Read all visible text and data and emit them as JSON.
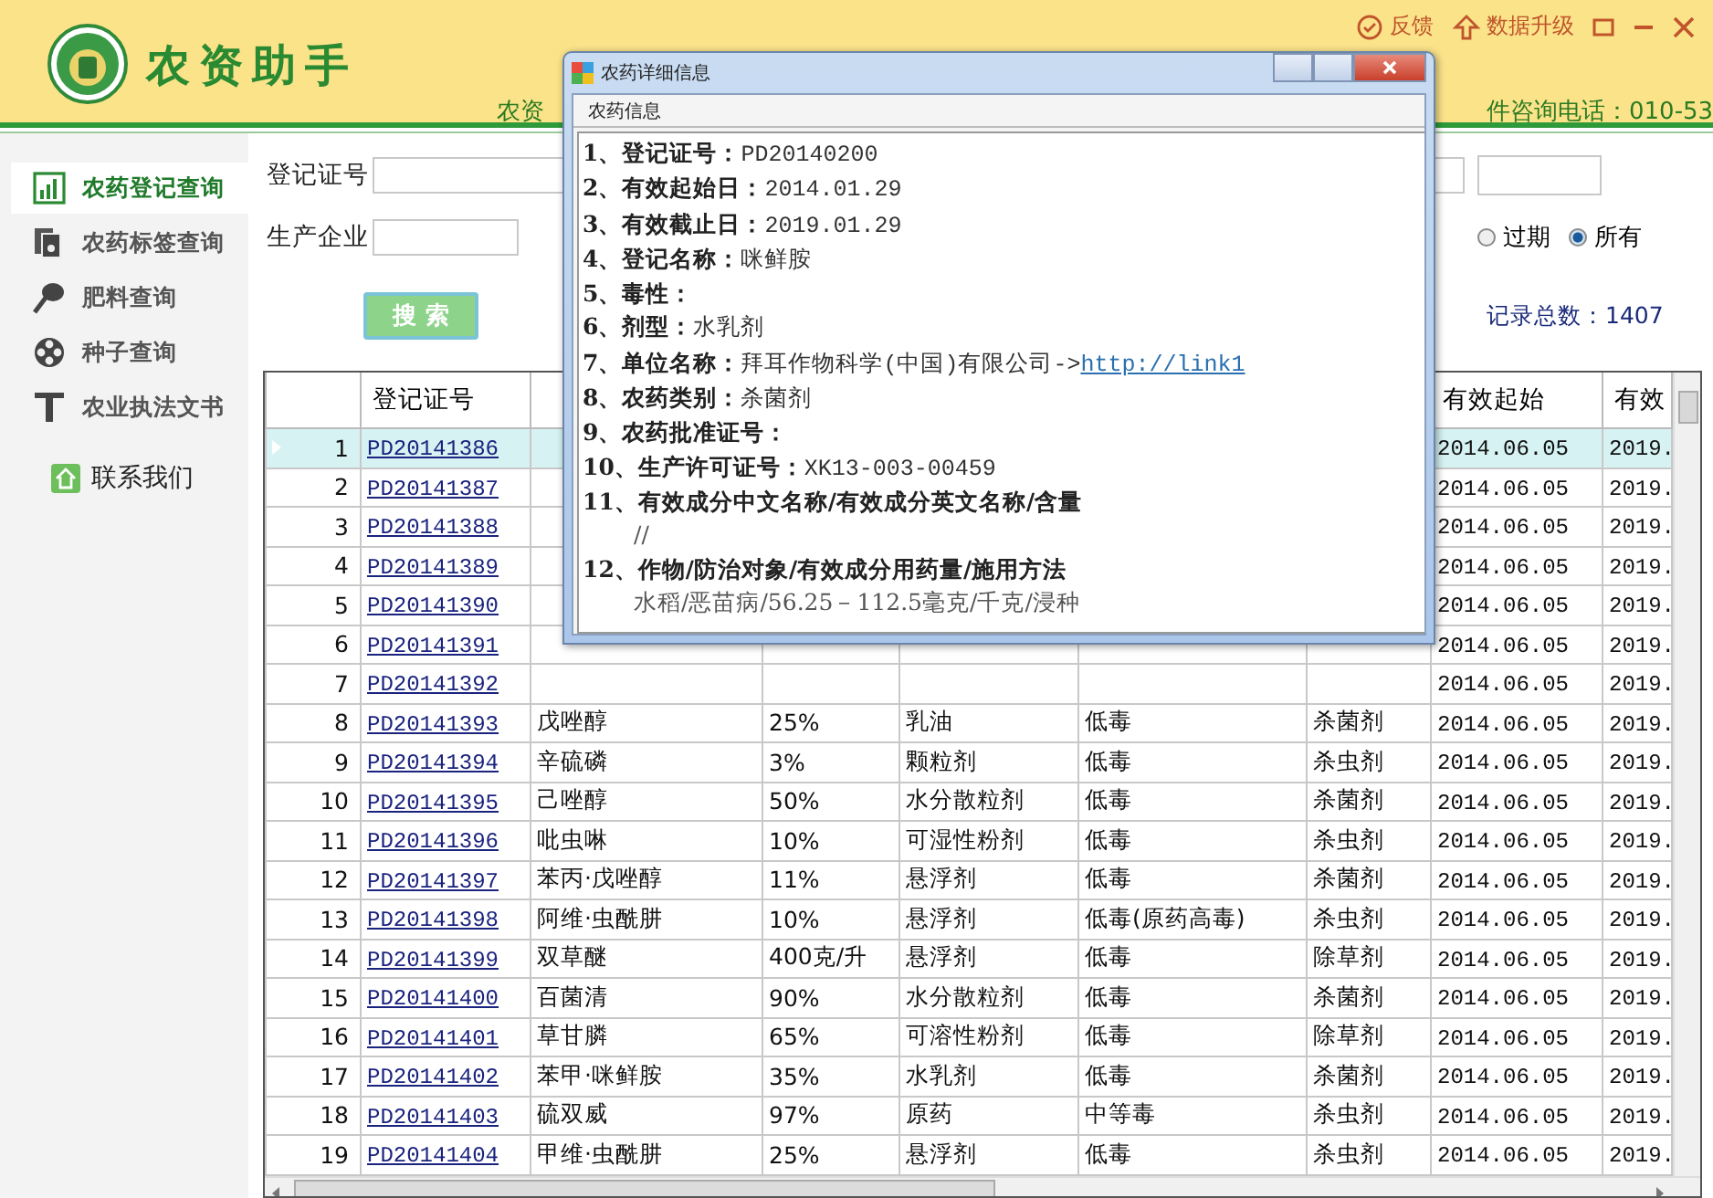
{
  "header": {
    "app_title": "农资助手",
    "marquee_left": "农资",
    "marquee_right": "件咨询电话：010-53",
    "actions": [
      {
        "kind": "feedback",
        "label": "反馈"
      },
      {
        "kind": "upgrade",
        "label": "数据升级"
      }
    ]
  },
  "sidebar": {
    "items": [
      {
        "kind": "chart",
        "label": "农药登记查询",
        "selected": true
      },
      {
        "kind": "label",
        "label": "农药标签查询",
        "selected": false
      },
      {
        "kind": "fertilizer",
        "label": "肥料查询",
        "selected": false
      },
      {
        "kind": "seed",
        "label": "种子查询",
        "selected": false
      },
      {
        "kind": "text",
        "label": "农业执法文书",
        "selected": false
      }
    ],
    "contact": {
      "label": "联系我们"
    }
  },
  "search": {
    "fields": [
      {
        "label": "登记证号"
      },
      {
        "label": "生产企业"
      }
    ],
    "button": "搜 索",
    "radios": [
      {
        "label": "过期",
        "selected": false
      },
      {
        "label": "所有",
        "selected": true
      }
    ],
    "record_count": "记录总数：1407"
  },
  "table": {
    "columns": {
      "reg": "登记证号",
      "start": "有效起始",
      "end": "有效"
    },
    "rows": [
      {
        "no": "1",
        "reg": "PD20141386",
        "start": "2014.06.05",
        "end": "2019.",
        "selected": true
      },
      {
        "no": "2",
        "reg": "PD20141387",
        "start": "2014.06.05",
        "end": "2019.",
        "selected": false
      },
      {
        "no": "3",
        "reg": "PD20141388",
        "start": "2014.06.05",
        "end": "2019.",
        "selected": false
      },
      {
        "no": "4",
        "reg": "PD20141389",
        "start": "2014.06.05",
        "end": "2019.",
        "selected": false
      },
      {
        "no": "5",
        "reg": "PD20141390",
        "start": "2014.06.05",
        "end": "2019.",
        "selected": false
      },
      {
        "no": "6",
        "reg": "PD20141391",
        "start": "2014.06.05",
        "end": "2019.",
        "selected": false
      },
      {
        "no": "7",
        "reg": "PD20141392",
        "start": "2014.06.05",
        "end": "2019.",
        "selected": false
      },
      {
        "no": "8",
        "reg": "PD20141393",
        "name": "戊唑醇",
        "content": "25%",
        "form": "乳油",
        "toxicity": "低毒",
        "category": "杀菌剂",
        "start": "2014.06.05",
        "end": "2019.",
        "selected": false
      },
      {
        "no": "9",
        "reg": "PD20141394",
        "name": "辛硫磷",
        "content": "3%",
        "form": "颗粒剂",
        "toxicity": "低毒",
        "category": "杀虫剂",
        "start": "2014.06.05",
        "end": "2019.",
        "selected": false
      },
      {
        "no": "10",
        "reg": "PD20141395",
        "name": "己唑醇",
        "content": "50%",
        "form": "水分散粒剂",
        "toxicity": "低毒",
        "category": "杀菌剂",
        "start": "2014.06.05",
        "end": "2019.",
        "selected": false
      },
      {
        "no": "11",
        "reg": "PD20141396",
        "name": "吡虫啉",
        "content": "10%",
        "form": "可湿性粉剂",
        "toxicity": "低毒",
        "category": "杀虫剂",
        "start": "2014.06.05",
        "end": "2019.",
        "selected": false
      },
      {
        "no": "12",
        "reg": "PD20141397",
        "name": "苯丙·戊唑醇",
        "content": "11%",
        "form": "悬浮剂",
        "toxicity": "低毒",
        "category": "杀菌剂",
        "start": "2014.06.05",
        "end": "2019.",
        "selected": false
      },
      {
        "no": "13",
        "reg": "PD20141398",
        "name": "阿维·虫酰肼",
        "content": "10%",
        "form": "悬浮剂",
        "toxicity": "低毒(原药高毒)",
        "category": "杀虫剂",
        "start": "2014.06.05",
        "end": "2019.",
        "selected": false
      },
      {
        "no": "14",
        "reg": "PD20141399",
        "name": "双草醚",
        "content": "400克/升",
        "form": "悬浮剂",
        "toxicity": "低毒",
        "category": "除草剂",
        "start": "2014.06.05",
        "end": "2019.",
        "selected": false
      },
      {
        "no": "15",
        "reg": "PD20141400",
        "name": "百菌清",
        "content": "90%",
        "form": "水分散粒剂",
        "toxicity": "低毒",
        "category": "杀菌剂",
        "start": "2014.06.05",
        "end": "2019.",
        "selected": false
      },
      {
        "no": "16",
        "reg": "PD20141401",
        "name": "草甘膦",
        "content": "65%",
        "form": "可溶性粉剂",
        "toxicity": "低毒",
        "category": "除草剂",
        "start": "2014.06.05",
        "end": "2019.",
        "selected": false
      },
      {
        "no": "17",
        "reg": "PD20141402",
        "name": "苯甲·咪鲜胺",
        "content": "35%",
        "form": "水乳剂",
        "toxicity": "低毒",
        "category": "杀菌剂",
        "start": "2014.06.05",
        "end": "2019.",
        "selected": false
      },
      {
        "no": "18",
        "reg": "PD20141403",
        "name": "硫双威",
        "content": "97%",
        "form": "原药",
        "toxicity": "中等毒",
        "category": "杀虫剂",
        "start": "2014.06.05",
        "end": "2019.",
        "selected": false
      },
      {
        "no": "19",
        "reg": "PD20141404",
        "name": "甲维·虫酰肼",
        "content": "25%",
        "form": "悬浮剂",
        "toxicity": "低毒",
        "category": "杀虫剂",
        "start": "2014.06.05",
        "end": "2019.",
        "selected": false
      }
    ]
  },
  "dialog": {
    "title": "农药详细信息",
    "tab": "农药信息",
    "lines": [
      {
        "label": "1、登记证号：",
        "value": "PD20140200"
      },
      {
        "label": "2、有效起始日：",
        "value": "2014.01.29"
      },
      {
        "label": "3、有效截止日：",
        "value": "2019.01.29"
      },
      {
        "label": "4、登记名称：",
        "value": "咪鲜胺"
      },
      {
        "label": "5、毒性："
      },
      {
        "label": "6、剂型：",
        "value": "水乳剂"
      },
      {
        "label": "7、单位名称：",
        "value": "拜耳作物科学(中国)有限公司->",
        "link": "http://link1"
      },
      {
        "label": "8、农药类别：",
        "value": "杀菌剂"
      },
      {
        "label": "9、农药批准证号："
      },
      {
        "label": "10、生产许可证号：",
        "value": "XK13-003-00459"
      },
      {
        "label": "11、有效成分中文名称/有效成分英文名称/含量",
        "detail": "//"
      },
      {
        "label": "12、作物/防治对象/有效成分用药量/施用方法",
        "detail": "水稻/恶苗病/56.25－112.5毫克/千克/浸种"
      }
    ]
  }
}
